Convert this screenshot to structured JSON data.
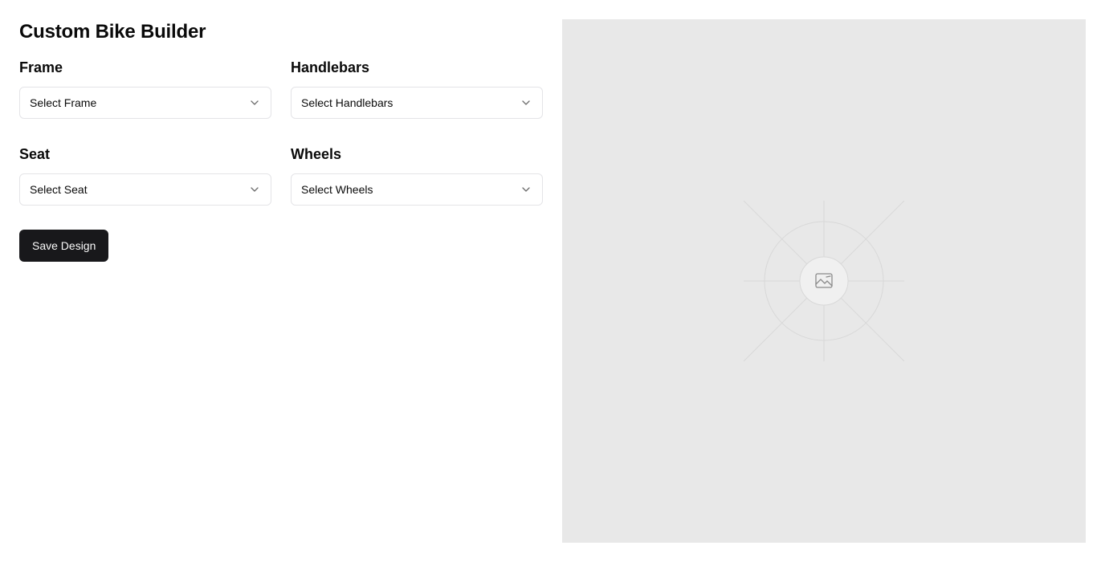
{
  "header": {
    "title": "Custom Bike Builder"
  },
  "fields": [
    {
      "label": "Frame",
      "placeholder": "Select Frame"
    },
    {
      "label": "Handlebars",
      "placeholder": "Select Handlebars"
    },
    {
      "label": "Seat",
      "placeholder": "Select Seat"
    },
    {
      "label": "Wheels",
      "placeholder": "Select Wheels"
    }
  ],
  "actions": {
    "save_label": "Save Design"
  },
  "preview": {
    "icon": "image-placeholder-icon"
  },
  "colors": {
    "primary_button": "#18181b",
    "preview_background": "#e8e8e8",
    "border": "#e4e4e7"
  }
}
